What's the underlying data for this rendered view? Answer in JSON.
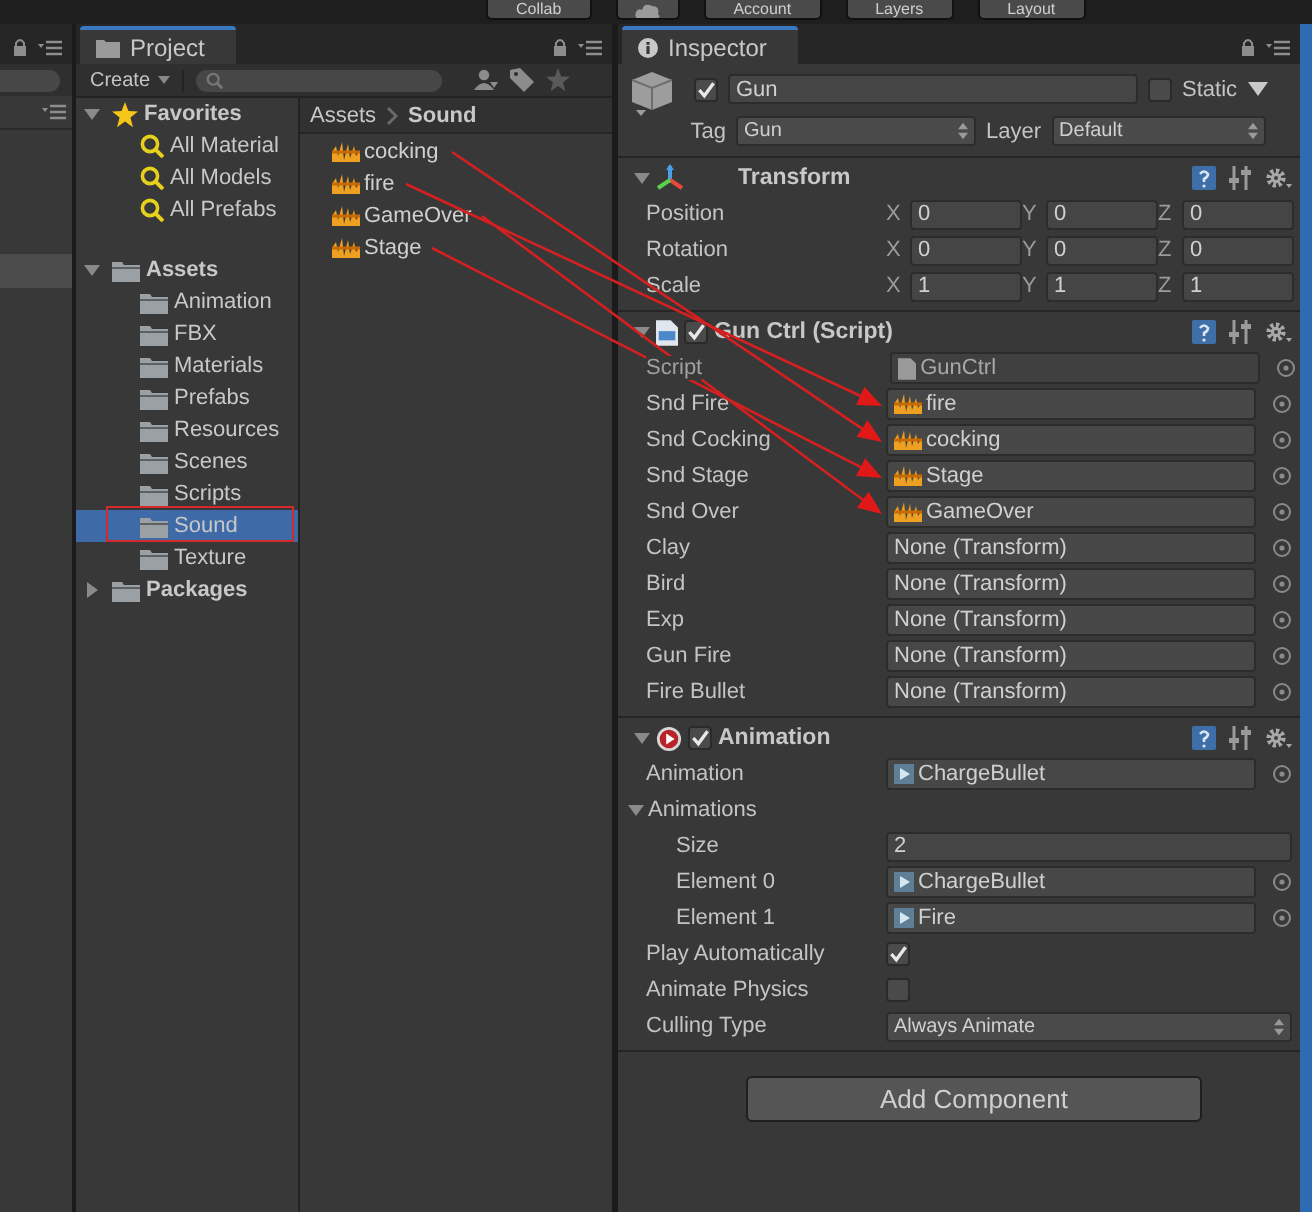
{
  "toolbar": {
    "buttons": [
      {
        "kind": "text",
        "label": "Collab"
      },
      {
        "kind": "icon"
      },
      {
        "kind": "text",
        "label": "Account"
      },
      {
        "kind": "text",
        "label": "Layers"
      },
      {
        "kind": "text",
        "label": "Layout"
      }
    ]
  },
  "hierarchy": {
    "rows": [
      {
        "selected": true
      }
    ]
  },
  "project": {
    "title": "Project",
    "create": "Create",
    "tree": [
      {
        "label": "Favorites",
        "kind": "favorites",
        "expanded": true,
        "children": [
          {
            "label": "All Material",
            "kind": "search",
            "selected": false,
            "outlined": false
          },
          {
            "label": "All Models",
            "kind": "search",
            "selected": false,
            "outlined": false
          },
          {
            "label": "All Prefabs",
            "kind": "search",
            "selected": false,
            "outlined": false
          }
        ]
      },
      {
        "label": "Assets",
        "kind": "folder",
        "expanded": true,
        "children": [
          {
            "label": "Animation",
            "kind": "folder",
            "selected": false,
            "outlined": false
          },
          {
            "label": "FBX",
            "kind": "folder",
            "selected": false,
            "outlined": false
          },
          {
            "label": "Materials",
            "kind": "folder",
            "selected": false,
            "outlined": false
          },
          {
            "label": "Prefabs",
            "kind": "folder",
            "selected": false,
            "outlined": false
          },
          {
            "label": "Resources",
            "kind": "folder",
            "selected": false,
            "outlined": false
          },
          {
            "label": "Scenes",
            "kind": "folder",
            "selected": false,
            "outlined": false
          },
          {
            "label": "Scripts",
            "kind": "folder",
            "selected": false,
            "outlined": false
          },
          {
            "label": "Sound",
            "kind": "folder",
            "selected": true,
            "outlined": true
          },
          {
            "label": "Texture",
            "kind": "folder",
            "selected": false,
            "outlined": false
          }
        ]
      },
      {
        "label": "Packages",
        "kind": "folder",
        "expanded": false
      }
    ],
    "breadcrumb": [
      "Assets",
      "Sound"
    ],
    "files": [
      {
        "name": "cocking"
      },
      {
        "name": "fire"
      },
      {
        "name": "GameOver"
      },
      {
        "name": "Stage"
      }
    ]
  },
  "annotation_arrows": true,
  "inspector": {
    "title": "Inspector",
    "object": {
      "active": true,
      "name": "Gun",
      "static": false,
      "static_label": "Static",
      "tag_label": "Tag",
      "tag": "Gun",
      "layer_label": "Layer",
      "layer": "Default"
    },
    "components": [
      {
        "kind": "transform",
        "title": "Transform",
        "expanded": true,
        "rows": [
          {
            "label": "Position",
            "axes": [
              {
                "axis": "X",
                "value": "0"
              },
              {
                "axis": "Y",
                "value": "0"
              },
              {
                "axis": "Z",
                "value": "0"
              }
            ]
          },
          {
            "label": "Rotation",
            "axes": [
              {
                "axis": "X",
                "value": "0"
              },
              {
                "axis": "Y",
                "value": "0"
              },
              {
                "axis": "Z",
                "value": "0"
              }
            ]
          },
          {
            "label": "Scale",
            "axes": [
              {
                "axis": "X",
                "value": "1"
              },
              {
                "axis": "Y",
                "value": "1"
              },
              {
                "axis": "Z",
                "value": "1"
              }
            ]
          }
        ]
      },
      {
        "kind": "script",
        "title": "Gun Ctrl (Script)",
        "expanded": true,
        "enabled": true,
        "fields": [
          {
            "label": "Script",
            "kind": "script",
            "value": "GunCtrl",
            "disabled": true
          },
          {
            "label": "Snd Fire",
            "kind": "audio",
            "value": "fire",
            "disabled": false
          },
          {
            "label": "Snd Cocking",
            "kind": "audio",
            "value": "cocking",
            "disabled": false
          },
          {
            "label": "Snd Stage",
            "kind": "audio",
            "value": "Stage",
            "disabled": false
          },
          {
            "label": "Snd Over",
            "kind": "audio",
            "value": "GameOver",
            "disabled": false
          },
          {
            "label": "Clay",
            "kind": "none",
            "value": "None (Transform)",
            "disabled": false
          },
          {
            "label": "Bird",
            "kind": "none",
            "value": "None (Transform)",
            "disabled": false
          },
          {
            "label": "Exp",
            "kind": "none",
            "value": "None (Transform)",
            "disabled": false
          },
          {
            "label": "Gun Fire",
            "kind": "none",
            "value": "None (Transform)",
            "disabled": false
          },
          {
            "label": "Fire Bullet",
            "kind": "none",
            "value": "None (Transform)",
            "disabled": false
          }
        ]
      },
      {
        "kind": "animation",
        "title": "Animation",
        "expanded": true,
        "enabled": true,
        "fields": [
          {
            "label": "Animation",
            "kind": "clip",
            "value": "ChargeBullet"
          },
          {
            "label": "Animations",
            "kind": "group",
            "expanded": true,
            "children": [
              {
                "label": "Size",
                "kind": "number",
                "value": "2"
              },
              {
                "label": "Element 0",
                "kind": "clip",
                "value": "ChargeBullet"
              },
              {
                "label": "Element 1",
                "kind": "clip",
                "value": "Fire"
              }
            ]
          },
          {
            "label": "Play Automatically",
            "kind": "checkbox",
            "checked": true
          },
          {
            "label": "Animate Physics",
            "kind": "checkbox",
            "checked": false
          },
          {
            "label": "Culling Type",
            "kind": "dropdown",
            "value": "Always Animate"
          }
        ]
      }
    ],
    "add_component": "Add Component"
  }
}
